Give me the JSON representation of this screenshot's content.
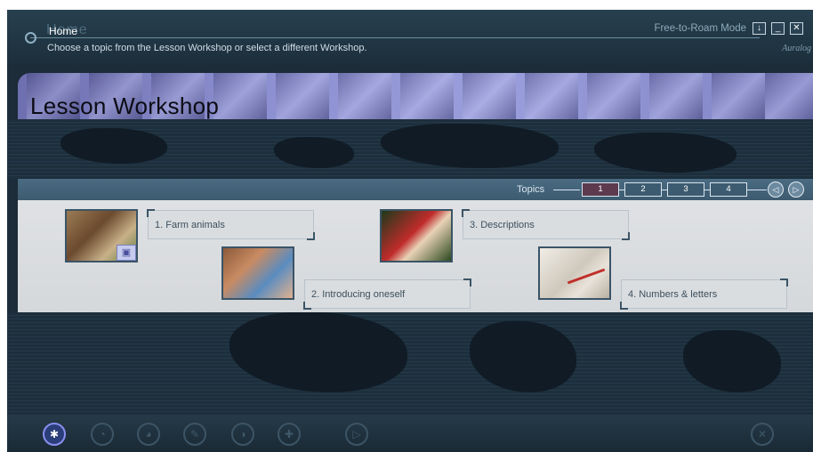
{
  "header": {
    "home_label": "Home",
    "home_ghost": "Home",
    "instructions": "Choose a topic from the Lesson Workshop or select a different Workshop.",
    "mode_label": "Free-to-Roam Mode",
    "logo_text": "Auralog",
    "window_buttons": {
      "download": "↓",
      "minimize": "_",
      "close": "✕"
    }
  },
  "banner": {
    "title": "Lesson Workshop"
  },
  "topics_bar": {
    "label": "Topics",
    "pages": [
      "1",
      "2",
      "3",
      "4"
    ],
    "active_page": "1",
    "prev_symbol": "◁",
    "next_symbol": "▷"
  },
  "topics": [
    {
      "label": "1. Farm animals",
      "has_video": true
    },
    {
      "label": "2. Introducing oneself",
      "has_video": false
    },
    {
      "label": "3. Descriptions",
      "has_video": false
    },
    {
      "label": "4. Numbers & letters",
      "has_video": false
    }
  ],
  "toolbar": {
    "icons": [
      "workshop-icon",
      "speech-icon",
      "listening-icon",
      "reading-icon",
      "pronunciation-icon",
      "grammar-icon",
      "next-icon",
      "exit-icon"
    ]
  },
  "colors": {
    "app_background": "#1c2c38",
    "banner": "#8c8fd0",
    "topics_bar": "#4a6b82",
    "content_panel": "#dfe1e4",
    "active_page": "#5d3a4e",
    "active_tool": "#8a8ff0"
  }
}
